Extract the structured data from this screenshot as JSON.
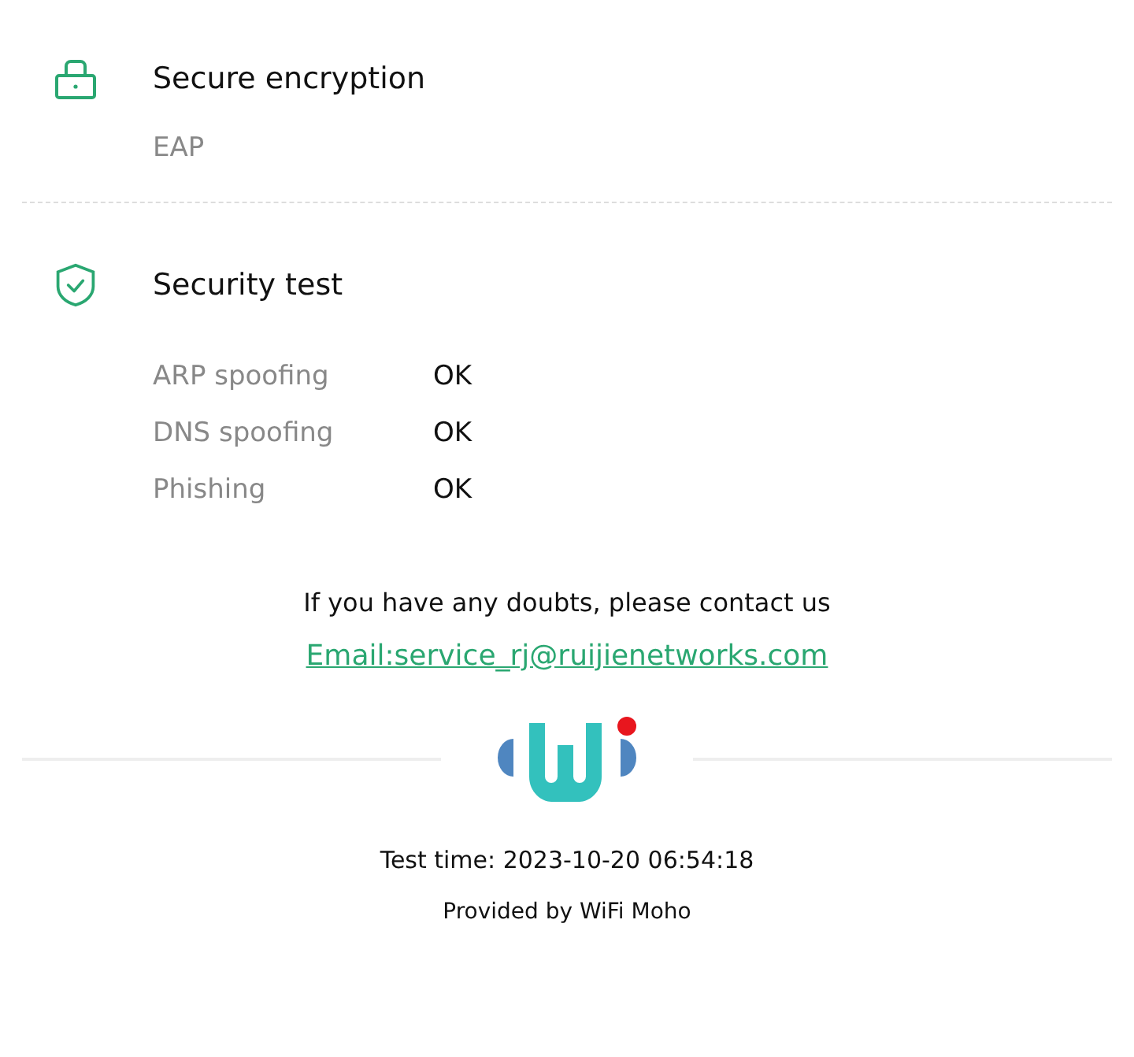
{
  "sections": [
    {
      "kind": "encryption",
      "title": "Secure encryption",
      "value": "EAP"
    },
    {
      "kind": "test",
      "title": "Security test",
      "rows": [
        {
          "label": "ARP spoofing",
          "result": "OK"
        },
        {
          "label": "DNS spoofing",
          "result": "OK"
        },
        {
          "label": "Phishing",
          "result": "OK"
        }
      ]
    }
  ],
  "contact": {
    "prompt": "If you have any doubts, please contact us",
    "email": "Email:service_rj@ruijienetworks.com"
  },
  "footer": {
    "test_time": "Test time: 2023-10-20 06:54:18",
    "provider": "Provided by WiFi Moho"
  }
}
